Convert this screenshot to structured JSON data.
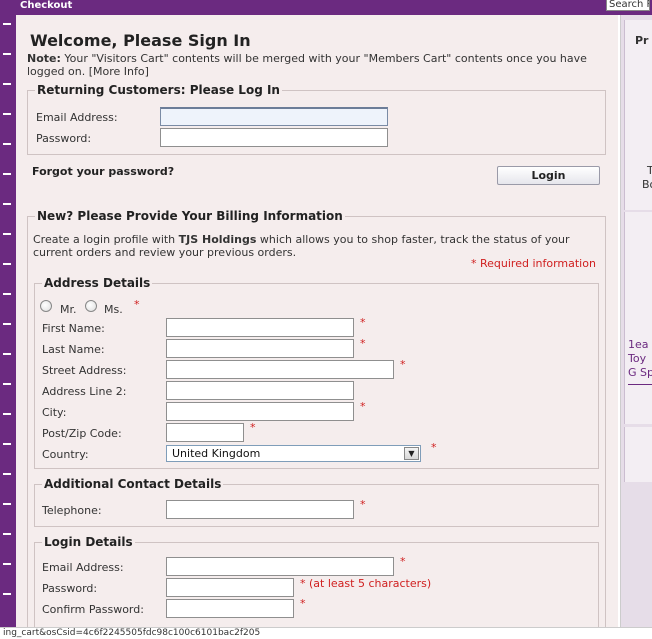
{
  "header": {
    "title": "Checkout",
    "search_value": "Search P"
  },
  "page": {
    "title": "Welcome, Please Sign In",
    "note_bold": "Note:",
    "note_text": " Your \"Visitors Cart\" contents will be merged with your \"Members Cart\" contents once you have logged on. [More Info]"
  },
  "returning": {
    "legend": "Returning Customers: Please Log In",
    "email_label": "Email Address:",
    "email_value": "",
    "password_label": "Password:",
    "password_value": "",
    "forgot": "Forgot your password?",
    "login_button": "Login"
  },
  "billing": {
    "legend": "New? Please Provide Your Billing Information",
    "intro_pre": "Create a login profile with ",
    "intro_brand": "TJS Holdings",
    "intro_post": " which allows you to shop faster, track the status of your current orders and review your previous orders.",
    "required_note": "* Required information",
    "required_mark": "*"
  },
  "address": {
    "legend": "Address Details",
    "mr": "Mr.",
    "ms": "Ms.",
    "first_name": "First Name:",
    "last_name": "Last Name:",
    "street": "Street Address:",
    "line2": "Address Line 2:",
    "city": "City:",
    "postcode": "Post/Zip Code:",
    "country": "Country:",
    "country_value": "United Kingdom"
  },
  "contact": {
    "legend": "Additional Contact Details",
    "telephone": "Telephone:"
  },
  "login_details": {
    "legend": "Login Details",
    "email": "Email Address:",
    "password": "Password:",
    "password_hint": "* (at least 5 characters)",
    "confirm": "Confirm Password:"
  },
  "right_panel": {
    "heading": "Pr",
    "t_line": "T",
    "bo_line": "Bo",
    "link1": "1ea",
    "link2": "Toy",
    "link3": "G Sp"
  },
  "status_bar": "ing_cart&osCsid=4c6f2245505fdc98c100c6101bac2f205"
}
